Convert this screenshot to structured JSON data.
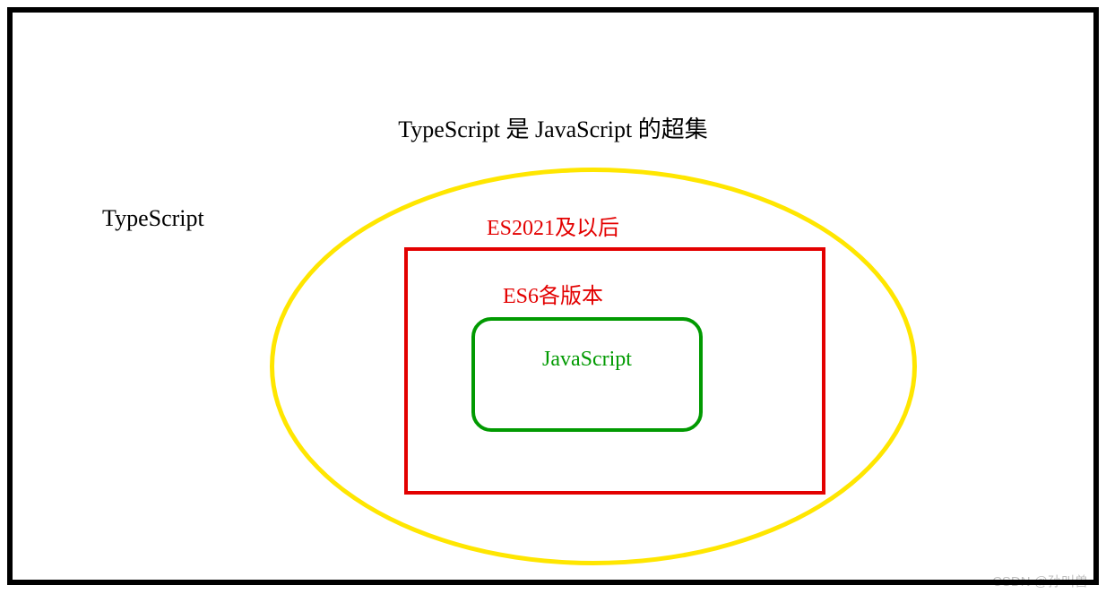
{
  "title": "TypeScript 是 JavaScript 的超集",
  "labels": {
    "typescript": "TypeScript",
    "es2021": "ES2021及以后",
    "es6": "ES6各版本",
    "javascript": "JavaScript"
  },
  "watermark": "CSDN @孙叫兽",
  "colors": {
    "frame": "#000000",
    "ellipse": "#ffe600",
    "rect_outer": "#e30000",
    "rect_inner": "#019a01"
  },
  "chart_data": {
    "type": "venn-nested",
    "description": "Nested superset diagram",
    "levels": [
      {
        "name": "TypeScript",
        "shape": "rectangle-frame",
        "color": "#000000"
      },
      {
        "name": "ES2021及以后",
        "shape": "ellipse",
        "color": "#ffe600"
      },
      {
        "name": "ES6各版本",
        "shape": "rectangle",
        "color": "#e30000"
      },
      {
        "name": "JavaScript",
        "shape": "rounded-rectangle",
        "color": "#019a01"
      }
    ],
    "title": "TypeScript 是 JavaScript 的超集"
  }
}
